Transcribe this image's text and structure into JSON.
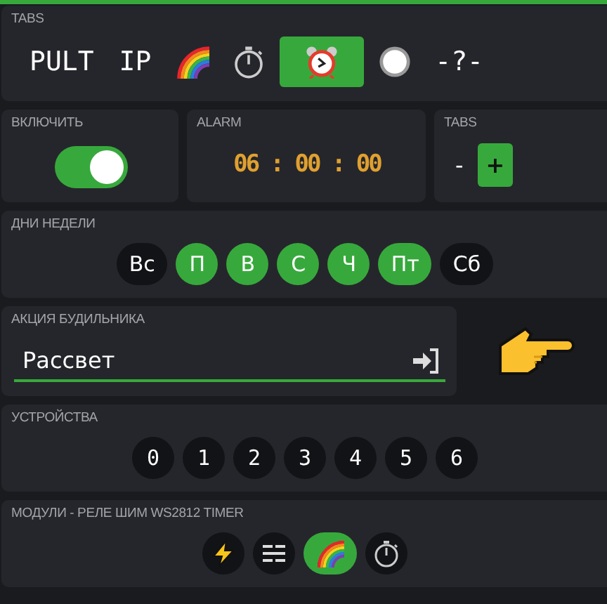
{
  "tabs_panel": {
    "label": "TABS",
    "tabs": [
      {
        "kind": "text",
        "label": "PULT",
        "selected": false
      },
      {
        "kind": "text",
        "label": "IP",
        "selected": false
      },
      {
        "kind": "rainbow",
        "selected": false
      },
      {
        "kind": "stopwatch",
        "selected": false
      },
      {
        "kind": "alarm",
        "selected": true
      },
      {
        "kind": "circle",
        "selected": false
      },
      {
        "kind": "text",
        "label": "-?-",
        "selected": false
      }
    ]
  },
  "enable": {
    "label": "ВКЛЮЧИТЬ",
    "on": true
  },
  "alarm": {
    "label": "ALARM",
    "time": "06 : 00 : 00"
  },
  "tabs_control": {
    "label": "TABS",
    "buttons": [
      {
        "label": "-",
        "selected": false
      },
      {
        "label": "+",
        "selected": true
      }
    ]
  },
  "weekdays": {
    "label": "ДНИ НЕДЕЛИ",
    "days": [
      {
        "label": "Вс",
        "selected": false
      },
      {
        "label": "П",
        "selected": true
      },
      {
        "label": "В",
        "selected": true
      },
      {
        "label": "С",
        "selected": true
      },
      {
        "label": "Ч",
        "selected": true
      },
      {
        "label": "Пт",
        "selected": true
      },
      {
        "label": "Сб",
        "selected": false
      }
    ]
  },
  "action": {
    "label": "АКЦИЯ БУДИЛЬНИКА",
    "value": "Рассвет"
  },
  "devices": {
    "label": "УСТРОЙСТВА",
    "items": [
      {
        "label": "0",
        "selected": false
      },
      {
        "label": "1",
        "selected": false
      },
      {
        "label": "2",
        "selected": false
      },
      {
        "label": "3",
        "selected": false
      },
      {
        "label": "4",
        "selected": false
      },
      {
        "label": "5",
        "selected": false
      },
      {
        "label": "6",
        "selected": false
      }
    ]
  },
  "modules": {
    "label": "МОДУЛИ - РЕЛЕ ШИМ WS2812 TIMER",
    "items": [
      {
        "kind": "bolt",
        "selected": false
      },
      {
        "kind": "lines",
        "selected": false
      },
      {
        "kind": "rainbow",
        "selected": true
      },
      {
        "kind": "stopwatch",
        "selected": false
      }
    ]
  }
}
